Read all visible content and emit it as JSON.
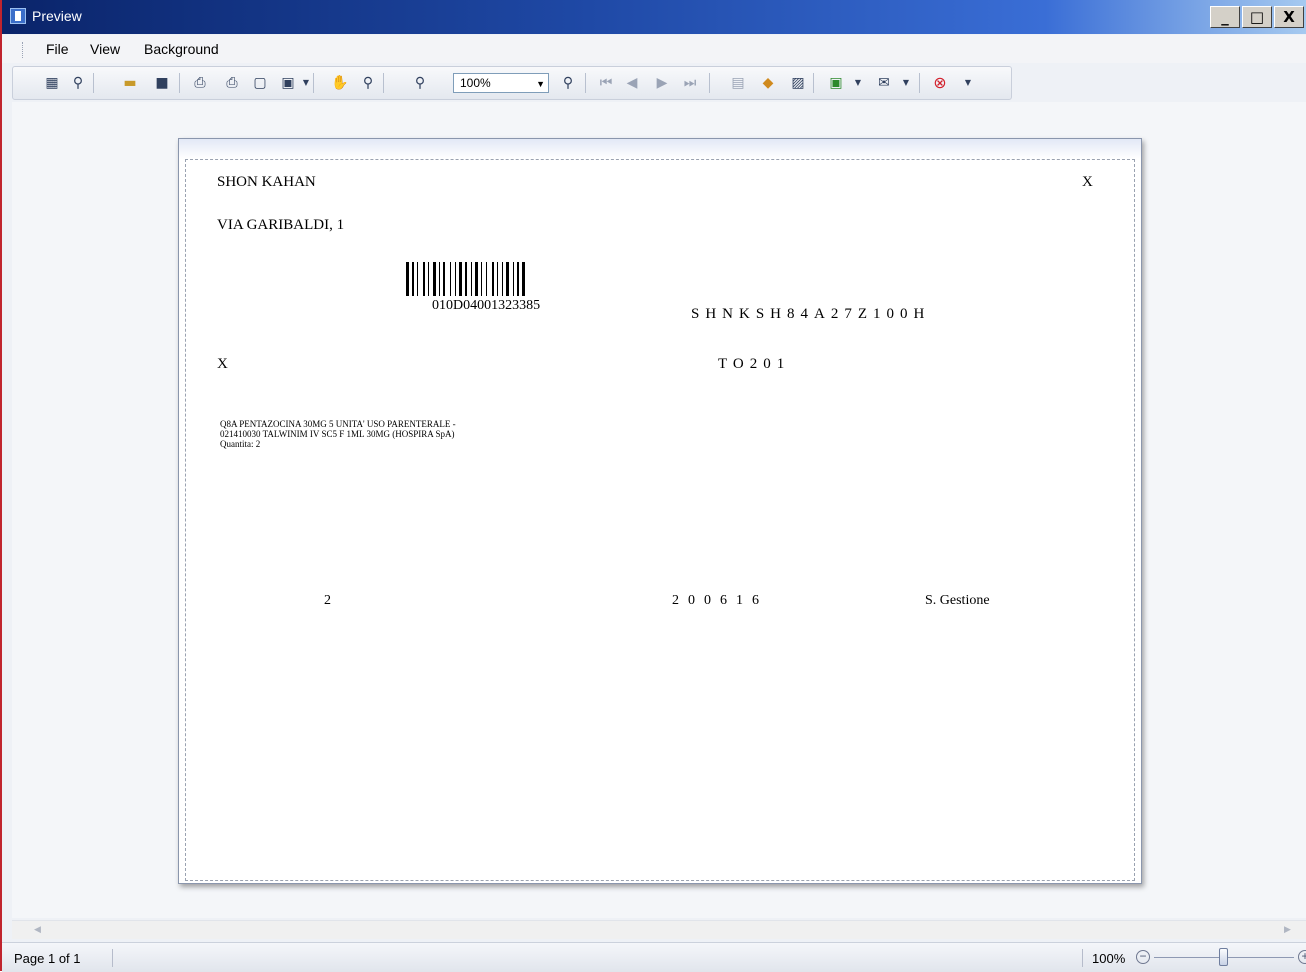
{
  "window": {
    "title": "Preview",
    "minimize_label": "_",
    "maximize_label": "□",
    "close_label": "X"
  },
  "menu": {
    "items": [
      "File",
      "View",
      "Background"
    ]
  },
  "toolbar": {
    "zoom_value": "100%",
    "icons": [
      "thumbnails-icon",
      "find-icon",
      "open-icon",
      "save-icon",
      "print-setup-icon",
      "print-icon",
      "quick-print-icon",
      "page-setup-icon",
      "hand-tool-icon",
      "magnifier-icon",
      "zoom-out-icon",
      "zoom-in-icon",
      "first-page-icon",
      "prev-page-icon",
      "next-page-icon",
      "last-page-icon",
      "multiple-pages-icon",
      "color-icon",
      "watermark-icon",
      "export-icon",
      "email-icon",
      "close-preview-icon"
    ]
  },
  "document": {
    "name": "SHON KAHAN",
    "corner_mark": "X",
    "address": "VIA GARIBALDI, 1",
    "barcode_number": "010D04001323385",
    "fiscal_code": "SHNKSH84A27Z100H",
    "left_mark": "X",
    "area_code": "TO201",
    "prescription_line1": "Q8A PENTAZOCINA 30MG 5 UNITA' USO PARENTERALE -",
    "prescription_line2": "021410030 TALWINIM IV SC5 F 1ML 30MG (HOSPIRA SpA)",
    "prescription_line3": "Quantita: 2",
    "quantity": "2",
    "date": "200616",
    "signature": "S. Gestione"
  },
  "status": {
    "page_label": "Page 1 of 1",
    "zoom_label": "100%",
    "zoom_minus": "−",
    "zoom_plus": "+"
  }
}
